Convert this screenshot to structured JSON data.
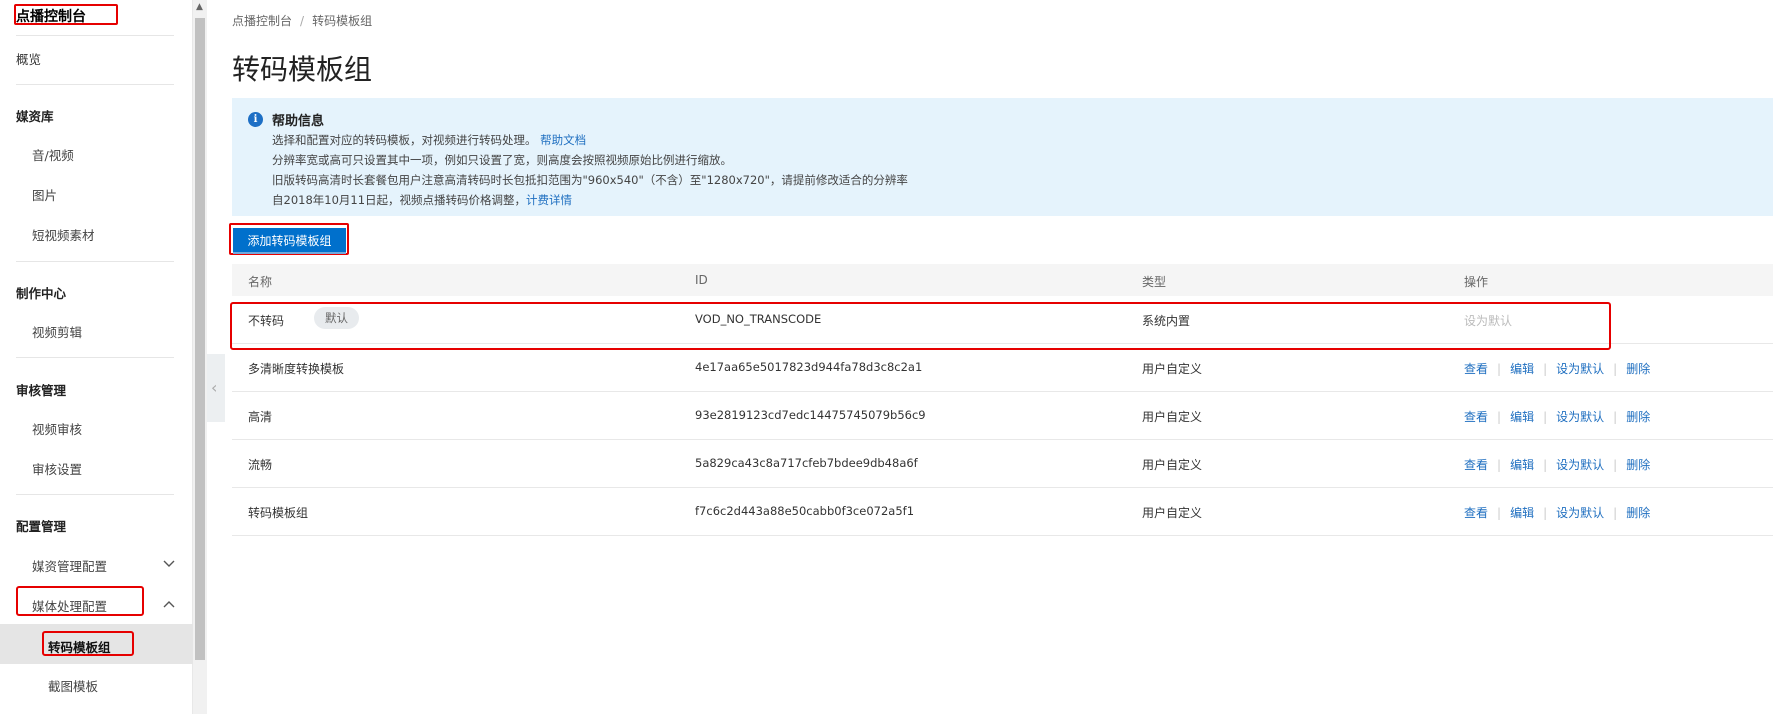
{
  "sidebar": {
    "title": "点播控制台",
    "overview": "概览",
    "groups": {
      "media_library": "媒资库",
      "production": "制作中心",
      "review": "审核管理",
      "config": "配置管理"
    },
    "items": {
      "audio_video": "音/视频",
      "images": "图片",
      "short_video": "短视频素材",
      "video_edit": "视频剪辑",
      "video_review": "视频审核",
      "review_settings": "审核设置",
      "media_mgmt_config": "媒资管理配置",
      "media_process_config": "媒体处理配置",
      "transcode_group": "转码模板组",
      "snapshot_template": "截图模板"
    }
  },
  "breadcrumb": {
    "root": "点播控制台",
    "sep": "/",
    "current": "转码模板组"
  },
  "page_title": "转码模板组",
  "help": {
    "title": "帮助信息",
    "line1": "选择和配置对应的转码模板，对视频进行转码处理。",
    "line1_link": "帮助文档",
    "line2": "分辨率宽或高可只设置其中一项，例如只设置了宽，则高度会按照视频原始比例进行缩放。",
    "line3": "旧版转码高清时长套餐包用户注意高清转码时长包抵扣范围为\"960x540\"（不含）至\"1280x720\"，请提前修改适合的分辨率",
    "line4": "自2018年10月11日起，视频点播转码价格调整，",
    "line4_link": "计费详情"
  },
  "add_button": "添加转码模板组",
  "table": {
    "headers": {
      "name": "名称",
      "id": "ID",
      "type": "类型",
      "ops": "操作"
    },
    "default_badge": "默认",
    "op_labels": {
      "view": "查看",
      "edit": "编辑",
      "set_default": "设为默认",
      "delete": "删除"
    },
    "rows": [
      {
        "name": "不转码",
        "id": "VOD_NO_TRANSCODE",
        "type": "系统内置",
        "set_default": "设为默认"
      },
      {
        "name": "多清晰度转换模板",
        "id": "4e17aa65e5017823d944fa78d3c8c2a1",
        "type": "用户自定义"
      },
      {
        "name": "高清",
        "id": "93e2819123cd7edc14475745079b56c9",
        "type": "用户自定义"
      },
      {
        "name": "流畅",
        "id": "5a829ca43c8a717cfeb7bdee9db48a6f",
        "type": "用户自定义"
      },
      {
        "name": "转码模板组",
        "id": "f7c6c2d443a88e50cabb0f3ce072a5f1",
        "type": "用户自定义"
      }
    ]
  },
  "colors": {
    "accent": "#0070cc",
    "link": "#1f6fc0",
    "highlight_box": "#e60000",
    "help_bg": "#e5f3fc"
  }
}
